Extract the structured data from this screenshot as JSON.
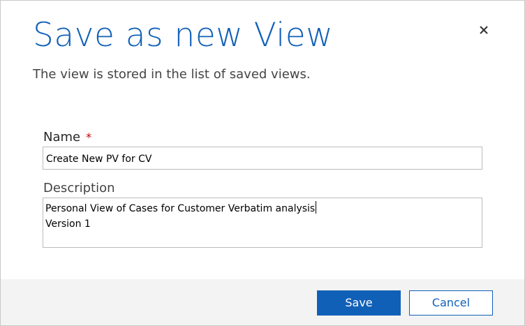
{
  "dialog": {
    "title": "Save as new View",
    "subtitle": "The view is stored in the list of saved views.",
    "close_icon": "close-icon"
  },
  "form": {
    "name_label": "Name",
    "required_marker": "*",
    "name_value": "Create New PV for CV",
    "description_label": "Description",
    "description_lines": [
      "Personal View of Cases for Customer Verbatim analysis",
      "Version 1"
    ]
  },
  "footer": {
    "save_label": "Save",
    "cancel_label": "Cancel"
  },
  "colors": {
    "accent": "#1160b7",
    "required": "#c00000",
    "footer_bg": "#f3f3f3"
  }
}
